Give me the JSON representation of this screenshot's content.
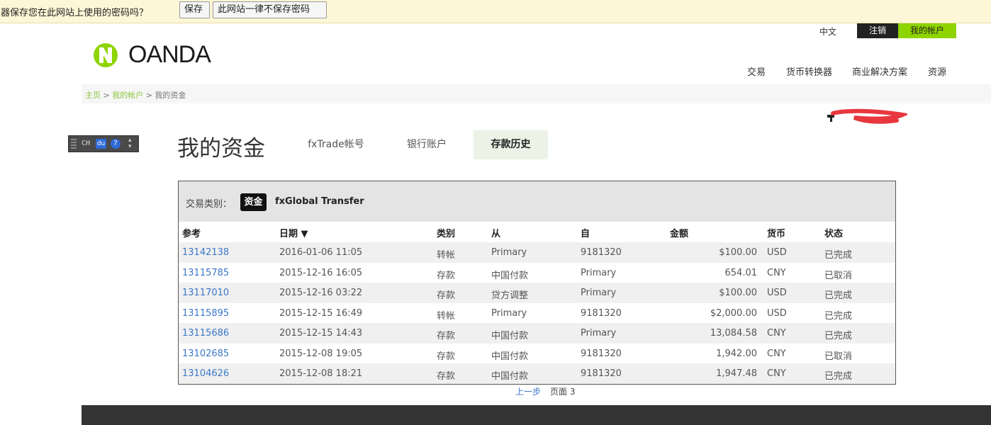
{
  "password_bar": {
    "message": "览器保存您在此网站上使用的密码吗？",
    "save_label": "保存",
    "never_label": "此网站一律不保存密码"
  },
  "top_links": {
    "language": "中文",
    "logout": "注销",
    "account": "我的帐户"
  },
  "logo": {
    "text": "OANDA"
  },
  "main_nav": [
    {
      "label": "交易"
    },
    {
      "label": "货币转换器"
    },
    {
      "label": "商业解决方案"
    },
    {
      "label": "资源"
    }
  ],
  "breadcrumb": {
    "home": "主页",
    "account": "我的帐户",
    "current": "我的资金",
    "separator": ">"
  },
  "ime": {
    "mode": "CH",
    "du": "du",
    "help": "?"
  },
  "page": {
    "title": "我的资金",
    "tabs": [
      {
        "label": "fxTrade帐号",
        "active": false
      },
      {
        "label": "银行账户",
        "active": false
      },
      {
        "label": "存款历史",
        "active": true
      }
    ]
  },
  "filter": {
    "label": "交易类别：",
    "options": [
      {
        "label": "资金",
        "selected": true
      },
      {
        "label": "fxGlobal Transfer",
        "selected": false
      }
    ]
  },
  "table": {
    "columns": [
      "参考",
      "日期 ▼",
      "类别",
      "从",
      "自",
      "金额",
      "货币",
      "状态"
    ],
    "rows": [
      {
        "ref": "13142138",
        "date": "2016-01-06 11:05",
        "type": "转帐",
        "from": "Primary",
        "to": "9181320",
        "amount": "$100.00",
        "currency": "USD",
        "status": "已完成"
      },
      {
        "ref": "13115785",
        "date": "2015-12-16 16:05",
        "type": "存款",
        "from": "中国付款",
        "to": "Primary",
        "amount": "654.01",
        "currency": "CNY",
        "status": "已取消"
      },
      {
        "ref": "13117010",
        "date": "2015-12-16 03:22",
        "type": "存款",
        "from": "贷方调整",
        "to": "Primary",
        "amount": "$100.00",
        "currency": "USD",
        "status": "已完成"
      },
      {
        "ref": "13115895",
        "date": "2015-12-15 16:49",
        "type": "转帐",
        "from": "Primary",
        "to": "9181320",
        "amount": "$2,000.00",
        "currency": "USD",
        "status": "已完成"
      },
      {
        "ref": "13115686",
        "date": "2015-12-15 14:43",
        "type": "存款",
        "from": "中国付款",
        "to": "Primary",
        "amount": "13,084.58",
        "currency": "CNY",
        "status": "已完成"
      },
      {
        "ref": "13102685",
        "date": "2015-12-08 19:05",
        "type": "存款",
        "from": "中国付款",
        "to": "9181320",
        "amount": "1,942.00",
        "currency": "CNY",
        "status": "已取消"
      },
      {
        "ref": "13104626",
        "date": "2015-12-08 18:21",
        "type": "存款",
        "from": "中国付款",
        "to": "9181320",
        "amount": "1,947.48",
        "currency": "CNY",
        "status": "已完成"
      }
    ]
  },
  "pager": {
    "prev": "上一步",
    "page": "页面 3"
  },
  "colors": {
    "accent": "#8ed400",
    "link": "#3b78c9",
    "dark": "#333333"
  }
}
